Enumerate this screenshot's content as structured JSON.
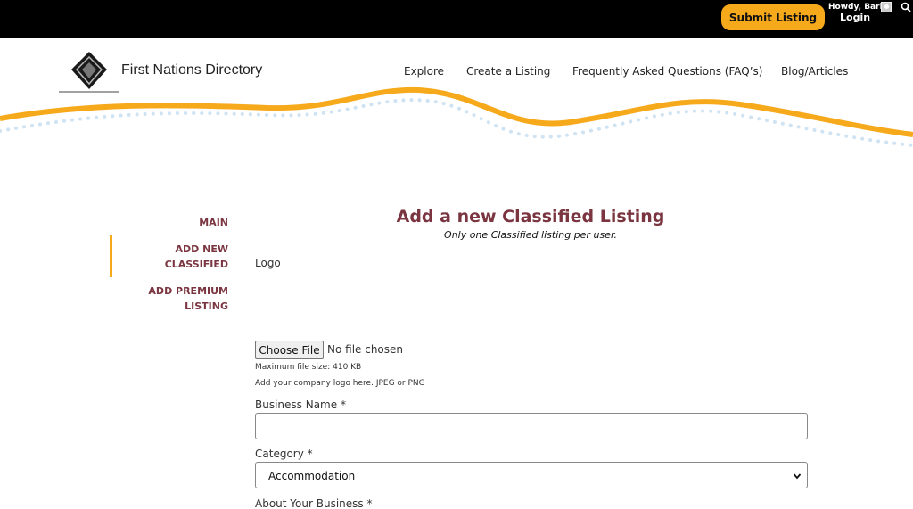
{
  "topbar": {
    "submit_label": "Submit Listing",
    "howdy": "Howdy, Barbi",
    "login": "Login"
  },
  "header": {
    "site_title": "First Nations Directory",
    "nav": [
      "Explore",
      "Create a Listing",
      "Frequently Asked Questions (FAQ’s)",
      "Blog/Articles"
    ]
  },
  "sidebar": {
    "items": [
      {
        "line1": "MAIN",
        "line2": ""
      },
      {
        "line1": "ADD NEW",
        "line2": "CLASSIFIED"
      },
      {
        "line1": "ADD PREMIUM",
        "line2": "LISTING"
      }
    ],
    "active_index": 1
  },
  "form": {
    "title": "Add a new Classified Listing",
    "subtitle": "Only one Classified listing per user.",
    "logo_label": "Logo",
    "file_button": "Choose File",
    "file_status": "No file chosen",
    "max_size": "Maximum file size: 410 KB",
    "logo_hint": "Add your company logo here. JPEG or PNG",
    "business_name_label": "Business Name *",
    "business_name_value": "",
    "category_label": "Category *",
    "category_value": "Accommodation",
    "about_label": "About Your Business *"
  },
  "colors": {
    "accent": "#f7a91c",
    "maroon": "#7a3540",
    "topbar": "#000000",
    "dots": "#cfe3f2"
  }
}
